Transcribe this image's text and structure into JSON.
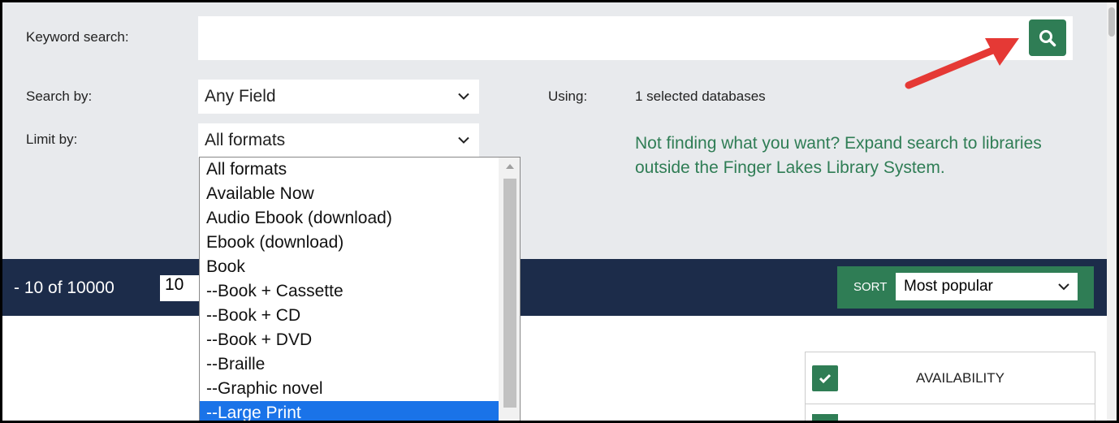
{
  "search": {
    "keyword_label": "Keyword search:",
    "keyword_value": "",
    "search_by_label": "Search by:",
    "search_by_value": "Any Field",
    "using_label": "Using:",
    "using_value": "1 selected databases",
    "limit_by_label": "Limit by:",
    "limit_by_value": "All formats",
    "expand_text": "Not finding what you want? Expand search to libraries outside the Finger Lakes Library System."
  },
  "format_dropdown": {
    "options": [
      "All formats",
      "Available Now",
      "Audio Ebook (download)",
      "Ebook (download)",
      "Book",
      "--Book + Cassette",
      "--Book + CD",
      "--Book + DVD",
      "--Braille",
      "--Graphic novel",
      "--Large Print"
    ],
    "highlighted": "--Large Print"
  },
  "results": {
    "count_text": "- 10 of 10000",
    "per_page": "10",
    "sort_label": "SORT",
    "sort_value": "Most popular"
  },
  "facets": {
    "availability_label": "AVAILABILITY"
  },
  "colors": {
    "accent": "#2f7d55",
    "navy": "#1c2c4a",
    "highlight": "#1a73e8",
    "annotation": "#e53935"
  },
  "icons": [
    "search-icon",
    "chevron-down-icon",
    "checkmark-icon",
    "annotation-arrow-icon"
  ]
}
